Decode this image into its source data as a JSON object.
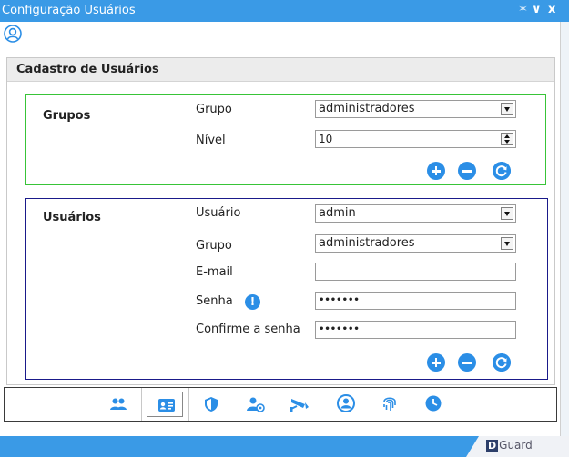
{
  "window": {
    "title": "Configuração Usuários",
    "controls": {
      "pin": "✶",
      "minimize": "∨",
      "close": "x"
    }
  },
  "panel": {
    "title": "Cadastro de Usuários"
  },
  "grupos": {
    "title": "Grupos",
    "grupo_label": "Grupo",
    "grupo_value": "administradores",
    "nivel_label": "Nível",
    "nivel_value": "10"
  },
  "usuarios": {
    "title": "Usuários",
    "usuario_label": "Usuário",
    "usuario_value": "admin",
    "grupo_label": "Grupo",
    "grupo_value": "administradores",
    "email_label": "E-mail",
    "email_value": "",
    "senha_label": "Senha",
    "senha_value": "•••••••",
    "confirme_label": "Confirme a senha",
    "confirme_value": "•••••••"
  },
  "footer": {
    "brand_letter": "D",
    "brand_name": "Guard"
  },
  "colors": {
    "accent": "#3a9ae6",
    "button": "#2b8ee6",
    "grupos_border": "#38c438",
    "usuarios_border": "#1a1a8a"
  },
  "toolbar": {
    "icons": [
      "users-icon",
      "id-card-icon",
      "shield-icon",
      "user-settings-icon",
      "camera-icon",
      "user-circle-icon",
      "fingerprint-icon",
      "clock-icon"
    ],
    "active": "id-card-icon"
  }
}
